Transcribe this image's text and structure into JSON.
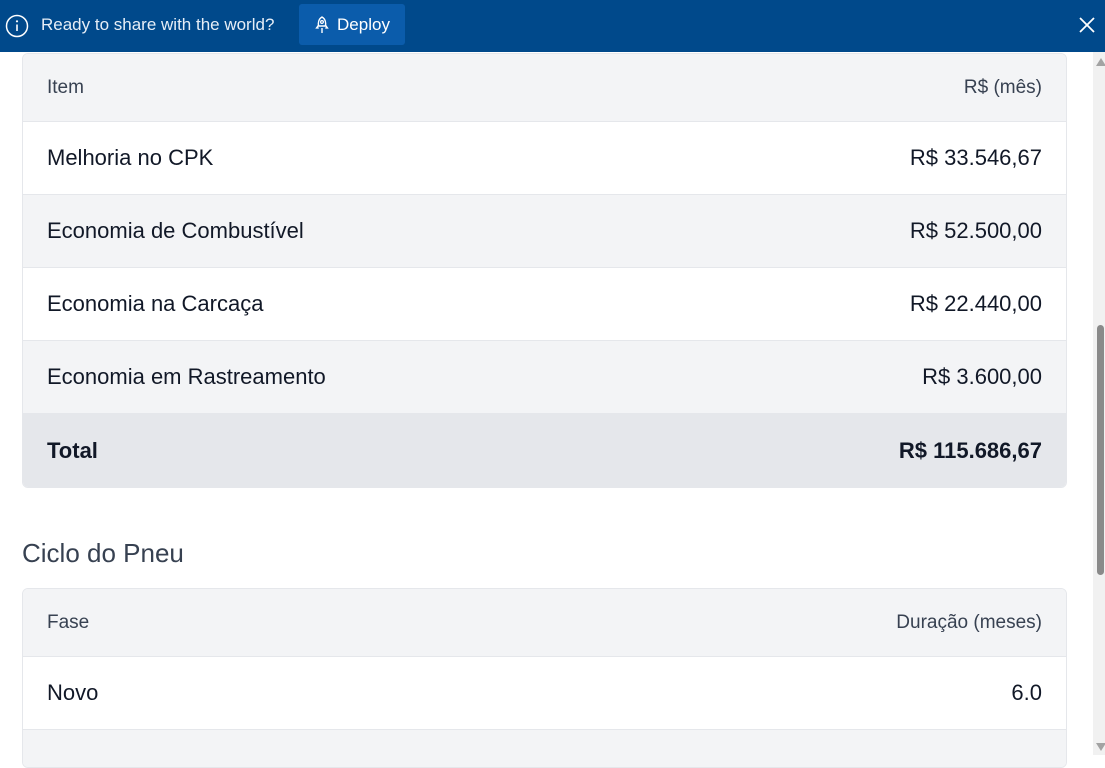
{
  "banner": {
    "message": "Ready to share with the world?",
    "deploy_label": "Deploy",
    "background": "#00498b"
  },
  "summary_table": {
    "header": {
      "item": "Item",
      "value": "R$ (mês)"
    },
    "rows": [
      {
        "item": "Melhoria no CPK",
        "value": "R$ 33.546,67"
      },
      {
        "item": "Economia de Combustível",
        "value": "R$ 52.500,00"
      },
      {
        "item": "Economia na Carcaça",
        "value": "R$ 22.440,00"
      },
      {
        "item": "Economia em Rastreamento",
        "value": "R$ 3.600,00"
      }
    ],
    "total": {
      "item": "Total",
      "value": "R$ 115.686,67"
    }
  },
  "cycle_section": {
    "title": "Ciclo do Pneu",
    "header": {
      "phase": "Fase",
      "duration": "Duração (meses)"
    },
    "rows": [
      {
        "phase": "Novo",
        "duration": "6.0"
      },
      {
        "phase": "",
        "duration": ""
      }
    ]
  },
  "icons": {
    "info": "info-icon",
    "deploy": "rocket-icon",
    "close": "close-icon"
  }
}
